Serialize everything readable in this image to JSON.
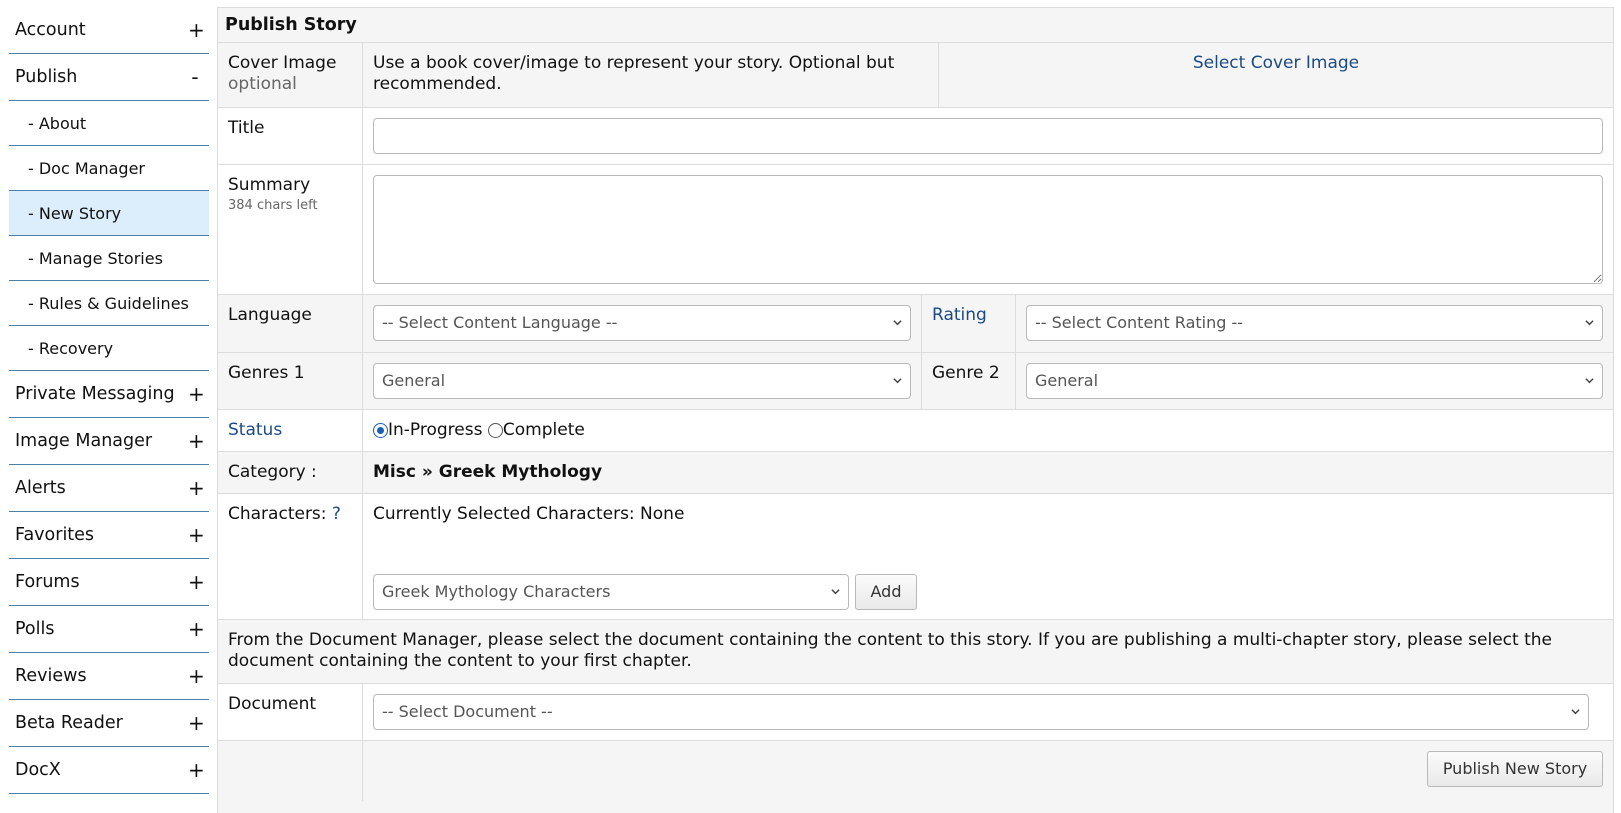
{
  "sidebar": {
    "items": [
      {
        "label": "Account",
        "toggle": "+"
      },
      {
        "label": "Publish",
        "toggle": "-"
      },
      {
        "label": "Private Messaging",
        "toggle": "+"
      },
      {
        "label": "Image Manager",
        "toggle": "+"
      },
      {
        "label": "Alerts",
        "toggle": "+"
      },
      {
        "label": "Favorites",
        "toggle": "+"
      },
      {
        "label": "Forums",
        "toggle": "+"
      },
      {
        "label": "Polls",
        "toggle": "+"
      },
      {
        "label": "Reviews",
        "toggle": "+"
      },
      {
        "label": "Beta Reader",
        "toggle": "+"
      },
      {
        "label": "DocX",
        "toggle": "+"
      }
    ],
    "publish_sub": [
      {
        "label": "- About"
      },
      {
        "label": "- Doc Manager"
      },
      {
        "label": "- New Story",
        "active": true
      },
      {
        "label": "- Manage Stories"
      },
      {
        "label": "- Rules & Guidelines"
      },
      {
        "label": "- Recovery"
      }
    ]
  },
  "form": {
    "title": "Publish Story",
    "cover": {
      "label": "Cover Image",
      "sublabel": "optional",
      "description": "Use a book cover/image to represent your story. Optional but recommended.",
      "link": "Select Cover Image"
    },
    "title_field": {
      "label": "Title",
      "value": ""
    },
    "summary": {
      "label": "Summary",
      "counter": "384 chars left",
      "value": ""
    },
    "language": {
      "label": "Language",
      "selected": "-- Select Content Language --"
    },
    "rating": {
      "label": "Rating",
      "selected": "-- Select Content Rating --"
    },
    "genre1": {
      "label": "Genres 1",
      "selected": "General"
    },
    "genre2": {
      "label": "Genre 2",
      "selected": "General"
    },
    "status": {
      "label": "Status",
      "options": [
        "In-Progress",
        "Complete"
      ],
      "selected": "In-Progress"
    },
    "category": {
      "label": "Category :",
      "value": "Misc » Greek Mythology"
    },
    "characters": {
      "label": "Characters:",
      "help": "?",
      "current": "Currently Selected Characters: None",
      "selected": "Greek Mythology Characters",
      "add_label": "Add"
    },
    "doc_note": "From the Document Manager, please select the document containing the content to this story. If you are publishing a multi-chapter story, please select the document containing the content to your first chapter.",
    "document": {
      "label": "Document",
      "selected": "-- Select Document --"
    },
    "submit_label": "Publish New Story"
  },
  "colors": {
    "link": "#1c4a84",
    "active_item": "#dcedfb",
    "sidebar_divider": "#4e7fa8",
    "radio_selected": "#1a5fb4"
  }
}
